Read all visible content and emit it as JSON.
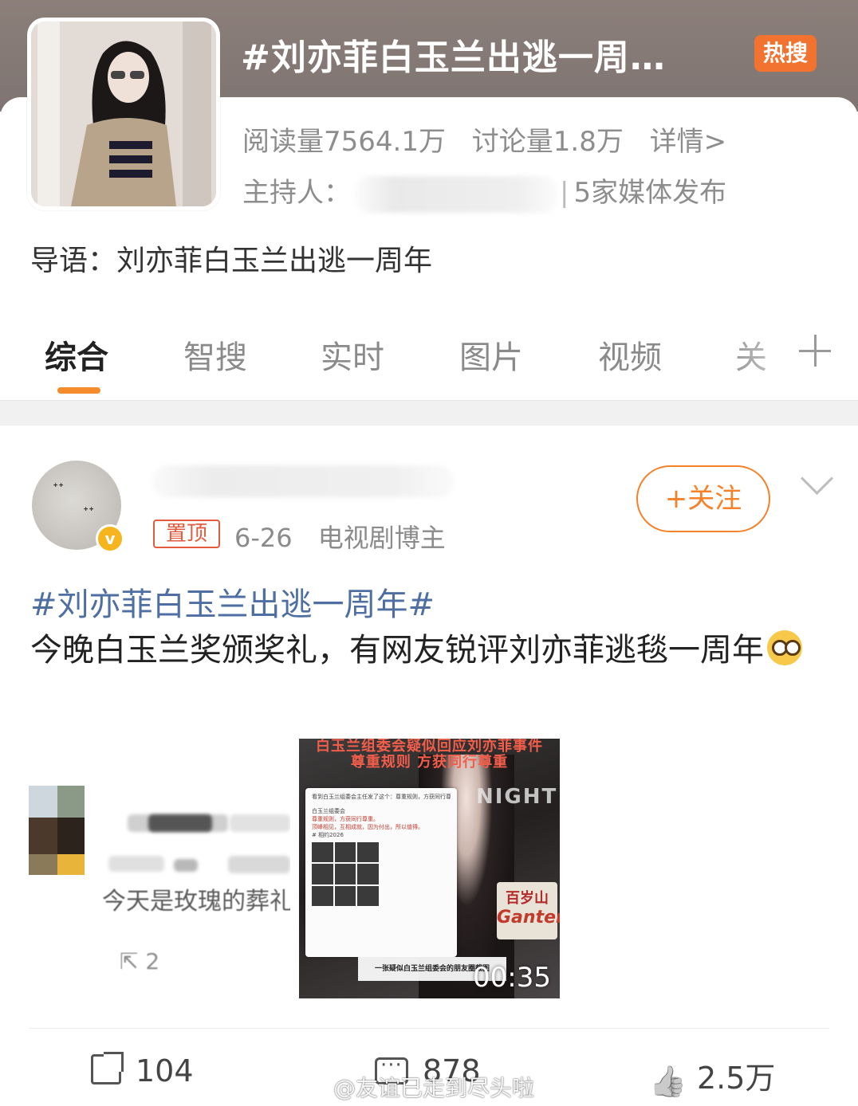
{
  "topic": {
    "title": "#刘亦菲白玉兰出逃一周…",
    "hot_badge": "热搜",
    "reads": "阅读量7564.1万",
    "discussions": "讨论量1.8万",
    "details_link": "详情>",
    "host_label": "主持人：",
    "host_sep": "|",
    "media_count": "5家媒体发布",
    "intro": "导语：刘亦菲白玉兰出逃一周年"
  },
  "tabs": [
    "综合",
    "智搜",
    "实时",
    "图片",
    "视频",
    "关"
  ],
  "post": {
    "pin": "置顶",
    "date": "6-26",
    "user_type": "电视剧博主",
    "follow_label": "+关注",
    "hashtag": "#刘亦菲白玉兰出逃一周年#",
    "text": "今晚白玉兰奖颁奖礼，有网友锐评刘亦菲逃毯一周年",
    "left_image_text": "今天是玫瑰的葬礼",
    "left_image_share": "2",
    "video": {
      "headline_1": "白玉兰组委会疑似回应刘亦菲事件",
      "headline_2": "尊重规则 方获同行尊重",
      "night": "NIGHT",
      "card_line_1": "看到白玉兰组委会主任发了这个：尊重规则，方获同行尊重",
      "card_line_2": "白玉兰组委会",
      "card_line_3": "尊重规则，方获同行尊重。",
      "card_line_4": "顶峰相见，互相成就，因为付出，所以值得。",
      "card_line_5": "# 相约2026",
      "brand_1": "百岁山",
      "brand_2": "Ganten",
      "caption": "一张疑似白玉兰组委会的朋友圈截图",
      "duration": "00:35"
    },
    "actions": {
      "share": "104",
      "comment": "878",
      "like": "2.5万"
    }
  },
  "watermark": "@友谊已走到尽头啦",
  "colors": {
    "accent_orange": "#f58b2c",
    "hot_badge": "#f2722f",
    "hashtag": "#4f6fa3",
    "pin_red": "#e55a3c"
  }
}
